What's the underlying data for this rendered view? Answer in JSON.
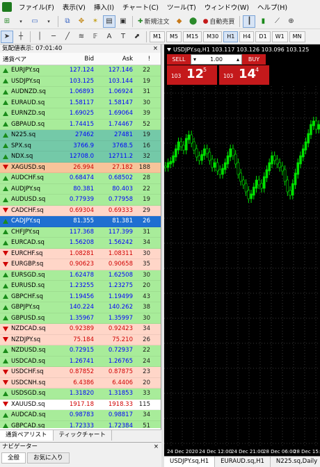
{
  "menu": [
    "ファイル(F)",
    "表示(V)",
    "挿入(I)",
    "チャート(C)",
    "ツール(T)",
    "ウィンドウ(W)",
    "ヘルプ(H)"
  ],
  "toolbar": {
    "new_order": "新規注文",
    "auto_trade": "自動売買"
  },
  "timeframes": [
    "M1",
    "M5",
    "M15",
    "M30",
    "H1",
    "H4",
    "D1",
    "W1",
    "MN"
  ],
  "active_timeframe": "H1",
  "market_watch": {
    "title": "気配値表示: 07:01:40",
    "headers": {
      "symbol": "通貨ペア",
      "bid": "Bid",
      "ask": "Ask",
      "spread": "!"
    },
    "rows": [
      {
        "symbol": "EURJPY.sq",
        "bid": "127.124",
        "ask": "127.146",
        "spread": "22",
        "state": "up"
      },
      {
        "symbol": "USDJPY.sq",
        "bid": "103.125",
        "ask": "103.144",
        "spread": "19",
        "state": "up"
      },
      {
        "symbol": "AUDNZD.sq",
        "bid": "1.06893",
        "ask": "1.06924",
        "spread": "31",
        "state": "up"
      },
      {
        "symbol": "EURAUD.sq",
        "bid": "1.58117",
        "ask": "1.58147",
        "spread": "30",
        "state": "up"
      },
      {
        "symbol": "EURNZD.sq",
        "bid": "1.69025",
        "ask": "1.69064",
        "spread": "39",
        "state": "up"
      },
      {
        "symbol": "GBPAUD.sq",
        "bid": "1.74415",
        "ask": "1.74467",
        "spread": "52",
        "state": "up"
      },
      {
        "symbol": "N225.sq",
        "bid": "27462",
        "ask": "27481",
        "spread": "19",
        "state": "teal"
      },
      {
        "symbol": "SPX.sq",
        "bid": "3766.9",
        "ask": "3768.5",
        "spread": "16",
        "state": "teal"
      },
      {
        "symbol": "NDX.sq",
        "bid": "12708.0",
        "ask": "12711.2",
        "spread": "32",
        "state": "teal"
      },
      {
        "symbol": "XAGUSD.sq",
        "bid": "26.994",
        "ask": "27.182",
        "spread": "188",
        "state": "orange"
      },
      {
        "symbol": "AUDCHF.sq",
        "bid": "0.68474",
        "ask": "0.68502",
        "spread": "28",
        "state": "up"
      },
      {
        "symbol": "AUDJPY.sq",
        "bid": "80.381",
        "ask": "80.403",
        "spread": "22",
        "state": "up"
      },
      {
        "symbol": "AUDUSD.sq",
        "bid": "0.77939",
        "ask": "0.77958",
        "spread": "19",
        "state": "up"
      },
      {
        "symbol": "CADCHF.sq",
        "bid": "0.69304",
        "ask": "0.69333",
        "spread": "29",
        "state": "down"
      },
      {
        "symbol": "CADJPY.sq",
        "bid": "81.355",
        "ask": "81.381",
        "spread": "26",
        "state": "sel"
      },
      {
        "symbol": "CHFJPY.sq",
        "bid": "117.368",
        "ask": "117.399",
        "spread": "31",
        "state": "up"
      },
      {
        "symbol": "EURCAD.sq",
        "bid": "1.56208",
        "ask": "1.56242",
        "spread": "34",
        "state": "up"
      },
      {
        "symbol": "EURCHF.sq",
        "bid": "1.08281",
        "ask": "1.08311",
        "spread": "30",
        "state": "down"
      },
      {
        "symbol": "EURGBP.sq",
        "bid": "0.90623",
        "ask": "0.90658",
        "spread": "35",
        "state": "down"
      },
      {
        "symbol": "EURSGD.sq",
        "bid": "1.62478",
        "ask": "1.62508",
        "spread": "30",
        "state": "up"
      },
      {
        "symbol": "EURUSD.sq",
        "bid": "1.23255",
        "ask": "1.23275",
        "spread": "20",
        "state": "up"
      },
      {
        "symbol": "GBPCHF.sq",
        "bid": "1.19456",
        "ask": "1.19499",
        "spread": "43",
        "state": "up"
      },
      {
        "symbol": "GBPJPY.sq",
        "bid": "140.224",
        "ask": "140.262",
        "spread": "38",
        "state": "up"
      },
      {
        "symbol": "GBPUSD.sq",
        "bid": "1.35967",
        "ask": "1.35997",
        "spread": "30",
        "state": "up"
      },
      {
        "symbol": "NZDCAD.sq",
        "bid": "0.92389",
        "ask": "0.92423",
        "spread": "34",
        "state": "down"
      },
      {
        "symbol": "NZDJPY.sq",
        "bid": "75.184",
        "ask": "75.210",
        "spread": "26",
        "state": "down"
      },
      {
        "symbol": "NZDUSD.sq",
        "bid": "0.72915",
        "ask": "0.72937",
        "spread": "22",
        "state": "up"
      },
      {
        "symbol": "USDCAD.sq",
        "bid": "1.26741",
        "ask": "1.26765",
        "spread": "24",
        "state": "up"
      },
      {
        "symbol": "USDCHF.sq",
        "bid": "0.87852",
        "ask": "0.87875",
        "spread": "23",
        "state": "down"
      },
      {
        "symbol": "USDCNH.sq",
        "bid": "6.4386",
        "ask": "6.4406",
        "spread": "20",
        "state": "down"
      },
      {
        "symbol": "USDSGD.sq",
        "bid": "1.31820",
        "ask": "1.31853",
        "spread": "33",
        "state": "up"
      },
      {
        "symbol": "XAUUSD.sq",
        "bid": "1917.18",
        "ask": "1918.33",
        "spread": "115",
        "state": "white"
      },
      {
        "symbol": "AUDCAD.sq",
        "bid": "0.98783",
        "ask": "0.98817",
        "spread": "34",
        "state": "up"
      },
      {
        "symbol": "GBPCAD.sq",
        "bid": "1.72333",
        "ask": "1.72384",
        "spread": "51",
        "state": "up"
      }
    ],
    "tabs": [
      "通貨ペアリスト",
      "ティックチャート"
    ]
  },
  "navigator": {
    "title": "ナビゲーター",
    "tabs": [
      "全般",
      "お気に入り"
    ]
  },
  "chart": {
    "title": "USDJPY.sq,H1  103.117 103.126 103.096 103.125",
    "sell": "SELL",
    "buy": "BUY",
    "lot": "1.00",
    "sell_price": {
      "prefix": "103",
      "big": "12",
      "sup": "5"
    },
    "buy_price": {
      "prefix": "103",
      "big": "14",
      "sup": "4"
    },
    "x_labels": [
      "24 Dec 2020",
      "24 Dec 12:00",
      "24 Dec 21:00",
      "28 Dec 06:00",
      "28 Dec 15:00"
    ],
    "tabs": [
      "USDJPY.sq,H1",
      "EURAUD.sq,H1",
      "N225.sq,Daily"
    ]
  },
  "colors": {
    "candle_up": "#00e000",
    "candle_down": "#000000",
    "candle_outline": "#00e000"
  }
}
